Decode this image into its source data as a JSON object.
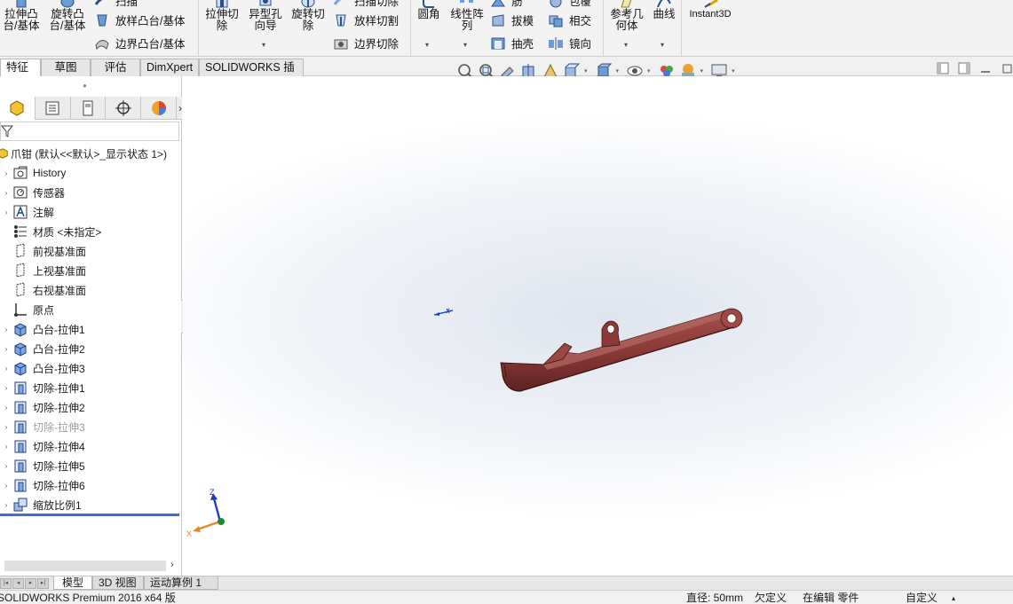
{
  "ribbon": {
    "extrude_boss": "拉伸凸\n台/基体",
    "revolve_boss": "旋转凸\n台/基体",
    "sweep_boss": "扫描",
    "loft_boss": "放样凸台/基体",
    "boundary_boss": "边界凸台/基体",
    "extrude_cut": "拉伸切\n除",
    "hole_wizard": "异型孔\n向导",
    "revolve_cut": "旋转切\n除",
    "sweep_cut": "扫描切除",
    "loft_cut": "放样切割",
    "boundary_cut": "边界切除",
    "fillet": "圆角",
    "linear_pattern": "线性阵\n列",
    "rib": "筋",
    "draft": "拔模",
    "shell": "抽壳",
    "wrap": "包覆",
    "intersect": "相交",
    "mirror": "镜向",
    "reference_geometry": "参考几\n何体",
    "curves": "曲线",
    "instant3d": "Instant3D"
  },
  "tabs": [
    "特征",
    "草图",
    "评估",
    "DimXpert",
    "SOLIDWORKS 插件"
  ],
  "tree": {
    "root": "爪钳 (默认<<默认>_显示状态 1>)",
    "items": [
      {
        "label": "History",
        "icon": "history-folder-icon",
        "disabled": false
      },
      {
        "label": "传感器",
        "icon": "sensor-icon",
        "disabled": false
      },
      {
        "label": "注解",
        "icon": "annotation-icon",
        "disabled": false
      },
      {
        "label": "材质 <未指定>",
        "icon": "material-icon",
        "disabled": false
      },
      {
        "label": "前视基准面",
        "icon": "plane-icon",
        "disabled": false
      },
      {
        "label": "上视基准面",
        "icon": "plane-icon",
        "disabled": false
      },
      {
        "label": "右视基准面",
        "icon": "plane-icon",
        "disabled": false
      },
      {
        "label": "原点",
        "icon": "origin-icon",
        "disabled": false
      },
      {
        "label": "凸台-拉伸1",
        "icon": "boss-extrude-icon",
        "disabled": false
      },
      {
        "label": "凸台-拉伸2",
        "icon": "boss-extrude-icon",
        "disabled": false
      },
      {
        "label": "凸台-拉伸3",
        "icon": "boss-extrude-icon",
        "disabled": false
      },
      {
        "label": "切除-拉伸1",
        "icon": "cut-extrude-icon",
        "disabled": false
      },
      {
        "label": "切除-拉伸2",
        "icon": "cut-extrude-icon",
        "disabled": false
      },
      {
        "label": "切除-拉伸3",
        "icon": "cut-extrude-icon",
        "disabled": true
      },
      {
        "label": "切除-拉伸4",
        "icon": "cut-extrude-icon",
        "disabled": false
      },
      {
        "label": "切除-拉伸5",
        "icon": "cut-extrude-icon",
        "disabled": false
      },
      {
        "label": "切除-拉伸6",
        "icon": "cut-extrude-icon",
        "disabled": false
      },
      {
        "label": "缩放比例1",
        "icon": "scale-icon",
        "disabled": false
      }
    ]
  },
  "triad": {
    "z": "Z",
    "x": "X"
  },
  "bottom_tabs": [
    "模型",
    "3D 视图",
    "运动算例 1"
  ],
  "status": {
    "app": "SOLIDWORKS Premium 2016 x64 版",
    "diameter": "直径: 50mm",
    "defined": "欠定义",
    "editing": "在编辑 零件",
    "custom": "自定义"
  },
  "colors": {
    "model": "#8b3a37",
    "accent": "#3c6fd1"
  }
}
